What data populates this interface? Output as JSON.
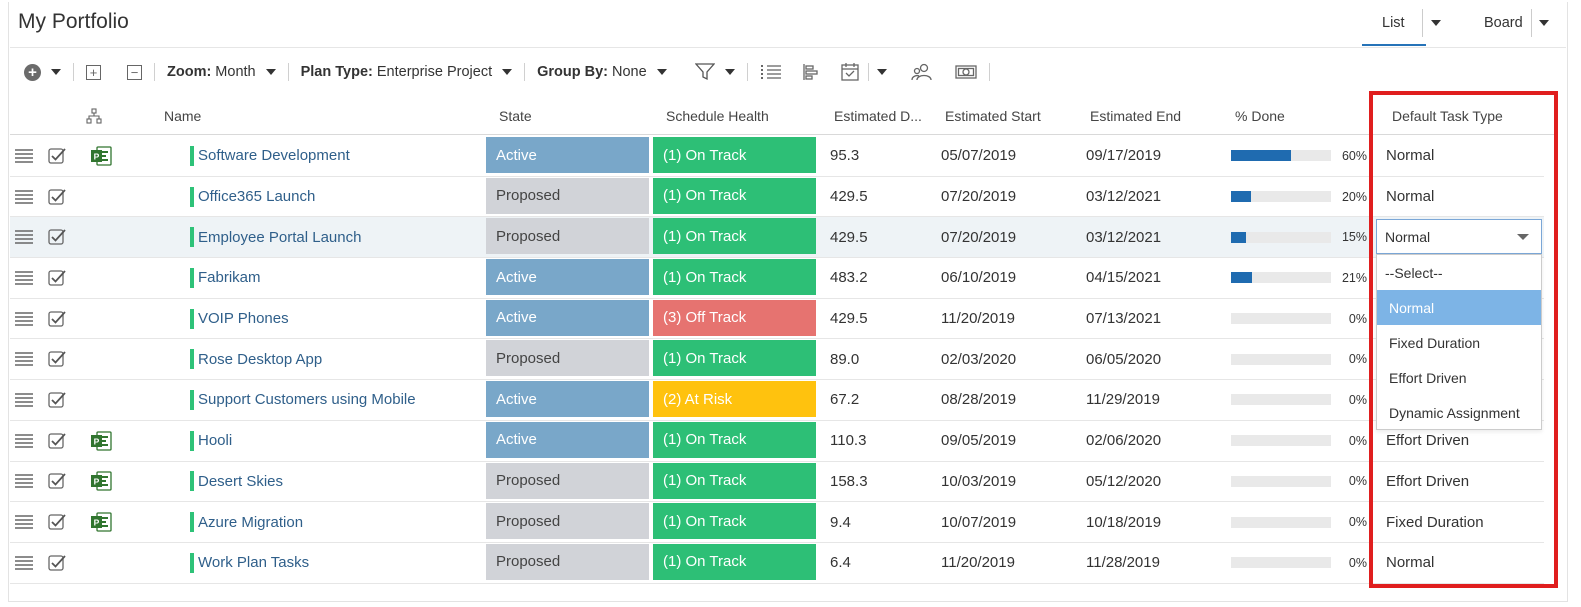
{
  "header": {
    "title": "My Portfolio",
    "tabs": [
      {
        "label": "List",
        "active": true
      },
      {
        "label": "Board",
        "active": false
      }
    ]
  },
  "toolbar": {
    "zoom": {
      "label": "Zoom:",
      "value": "Month"
    },
    "plan_type": {
      "label": "Plan Type:",
      "value": "Enterprise Project"
    },
    "group_by": {
      "label": "Group By:",
      "value": "None"
    }
  },
  "columns": {
    "name": "Name",
    "state": "State",
    "schedule_health": "Schedule Health",
    "estimated_duration": "Estimated D...",
    "estimated_start": "Estimated Start",
    "estimated_end": "Estimated End",
    "percent_done": "% Done",
    "default_task_type": "Default Task Type"
  },
  "rows": [
    {
      "name": "Software Development",
      "project_icon": true,
      "state": "Active",
      "health": "(1) On Track",
      "health_kind": "ontrack",
      "duration": "95.3",
      "start": "05/07/2019",
      "end": "09/17/2019",
      "pct": 60,
      "pct_label": "60%",
      "task_type": "Normal"
    },
    {
      "name": "Office365 Launch",
      "project_icon": false,
      "state": "Proposed",
      "health": "(1) On Track",
      "health_kind": "ontrack",
      "duration": "429.5",
      "start": "07/20/2019",
      "end": "03/12/2021",
      "pct": 20,
      "pct_label": "20%",
      "task_type": "Normal"
    },
    {
      "name": "Employee Portal Launch",
      "project_icon": false,
      "state": "Proposed",
      "health": "(1) On Track",
      "health_kind": "ontrack",
      "duration": "429.5",
      "start": "07/20/2019",
      "end": "03/12/2021",
      "pct": 15,
      "pct_label": "15%",
      "task_type": ""
    },
    {
      "name": "Fabrikam",
      "project_icon": false,
      "state": "Active",
      "health": "(1) On Track",
      "health_kind": "ontrack",
      "duration": "483.2",
      "start": "06/10/2019",
      "end": "04/15/2021",
      "pct": 21,
      "pct_label": "21%",
      "task_type": ""
    },
    {
      "name": "VOIP Phones",
      "project_icon": false,
      "state": "Active",
      "health": "(3) Off Track",
      "health_kind": "offtrack",
      "duration": "429.5",
      "start": "11/20/2019",
      "end": "07/13/2021",
      "pct": 0,
      "pct_label": "0%",
      "task_type": ""
    },
    {
      "name": "Rose Desktop App",
      "project_icon": false,
      "state": "Proposed",
      "health": "(1) On Track",
      "health_kind": "ontrack",
      "duration": "89.0",
      "start": "02/03/2020",
      "end": "06/05/2020",
      "pct": 0,
      "pct_label": "0%",
      "task_type": ""
    },
    {
      "name": "Support Customers using Mobile",
      "project_icon": false,
      "state": "Active",
      "health": "(2) At Risk",
      "health_kind": "atrisk",
      "duration": "67.2",
      "start": "08/28/2019",
      "end": "11/29/2019",
      "pct": 0,
      "pct_label": "0%",
      "task_type": ""
    },
    {
      "name": "Hooli",
      "project_icon": true,
      "state": "Active",
      "health": "(1) On Track",
      "health_kind": "ontrack",
      "duration": "110.3",
      "start": "09/05/2019",
      "end": "02/06/2020",
      "pct": 0,
      "pct_label": "0%",
      "task_type": "Effort Driven"
    },
    {
      "name": "Desert Skies",
      "project_icon": true,
      "state": "Proposed",
      "health": "(1) On Track",
      "health_kind": "ontrack",
      "duration": "158.3",
      "start": "10/03/2019",
      "end": "05/12/2020",
      "pct": 0,
      "pct_label": "0%",
      "task_type": "Effort Driven"
    },
    {
      "name": "Azure Migration",
      "project_icon": true,
      "state": "Proposed",
      "health": "(1) On Track",
      "health_kind": "ontrack",
      "duration": "9.4",
      "start": "10/07/2019",
      "end": "10/18/2019",
      "pct": 0,
      "pct_label": "0%",
      "task_type": "Fixed Duration"
    },
    {
      "name": "Work Plan Tasks",
      "project_icon": false,
      "state": "Proposed",
      "health": "(1) On Track",
      "health_kind": "ontrack",
      "duration": "6.4",
      "start": "11/20/2019",
      "end": "11/28/2019",
      "pct": 0,
      "pct_label": "0%",
      "task_type": "Normal"
    }
  ],
  "dropdown": {
    "selected": "Normal",
    "options": [
      "--Select--",
      "Normal",
      "Fixed Duration",
      "Effort Driven",
      "Dynamic Assignment"
    ],
    "highlighted": "Normal"
  },
  "colors": {
    "accent": "#2673b8",
    "state_active": "#79a7c9",
    "state_proposed": "#d1d3d8",
    "on_track": "#2dbf76",
    "off_track": "#e67370",
    "at_risk": "#ffc20e",
    "highlight_box": "#e01e1e"
  }
}
